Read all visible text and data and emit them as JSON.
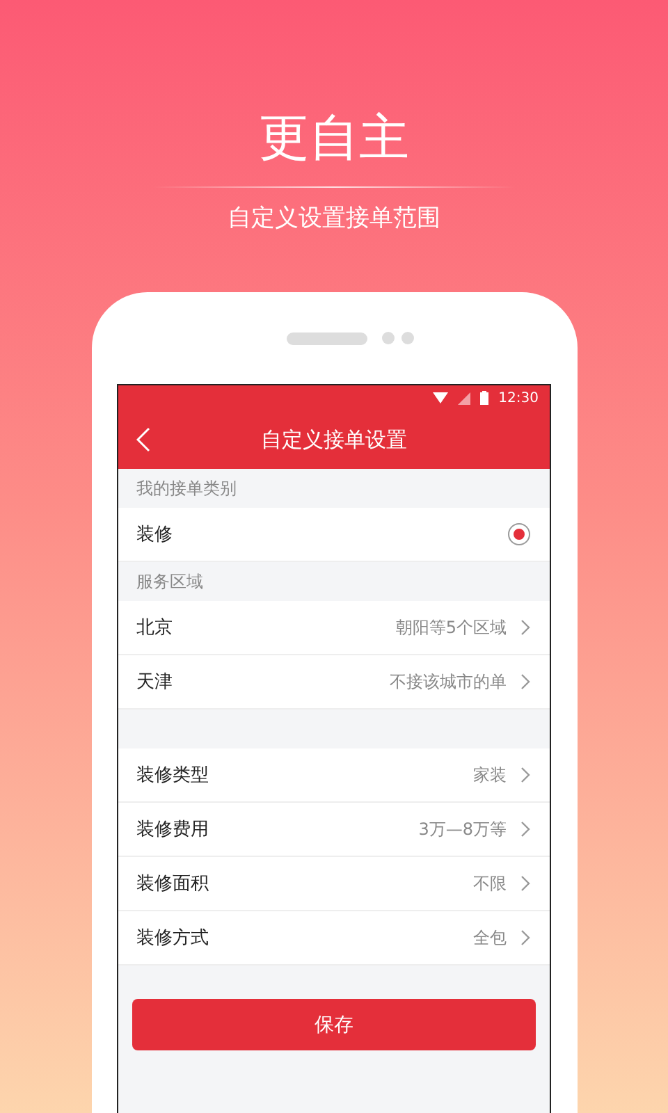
{
  "headline": "更自主",
  "subheadline": "自定义设置接单范围",
  "status_bar": {
    "time": "12:30"
  },
  "app_bar": {
    "title": "自定义接单设置"
  },
  "category_section": {
    "header": "我的接单类别",
    "items": [
      {
        "label": "装修",
        "selected": true
      }
    ]
  },
  "region_section": {
    "header": "服务区域",
    "rows": [
      {
        "label": "北京",
        "value": "朝阳等5个区域"
      },
      {
        "label": "天津",
        "value": "不接该城市的单"
      }
    ]
  },
  "settings_rows": [
    {
      "label": "装修类型",
      "value": "家装"
    },
    {
      "label": "装修费用",
      "value": "3万—8万等"
    },
    {
      "label": "装修面积",
      "value": "不限"
    },
    {
      "label": "装修方式",
      "value": "全包"
    }
  ],
  "save_button": "保存"
}
